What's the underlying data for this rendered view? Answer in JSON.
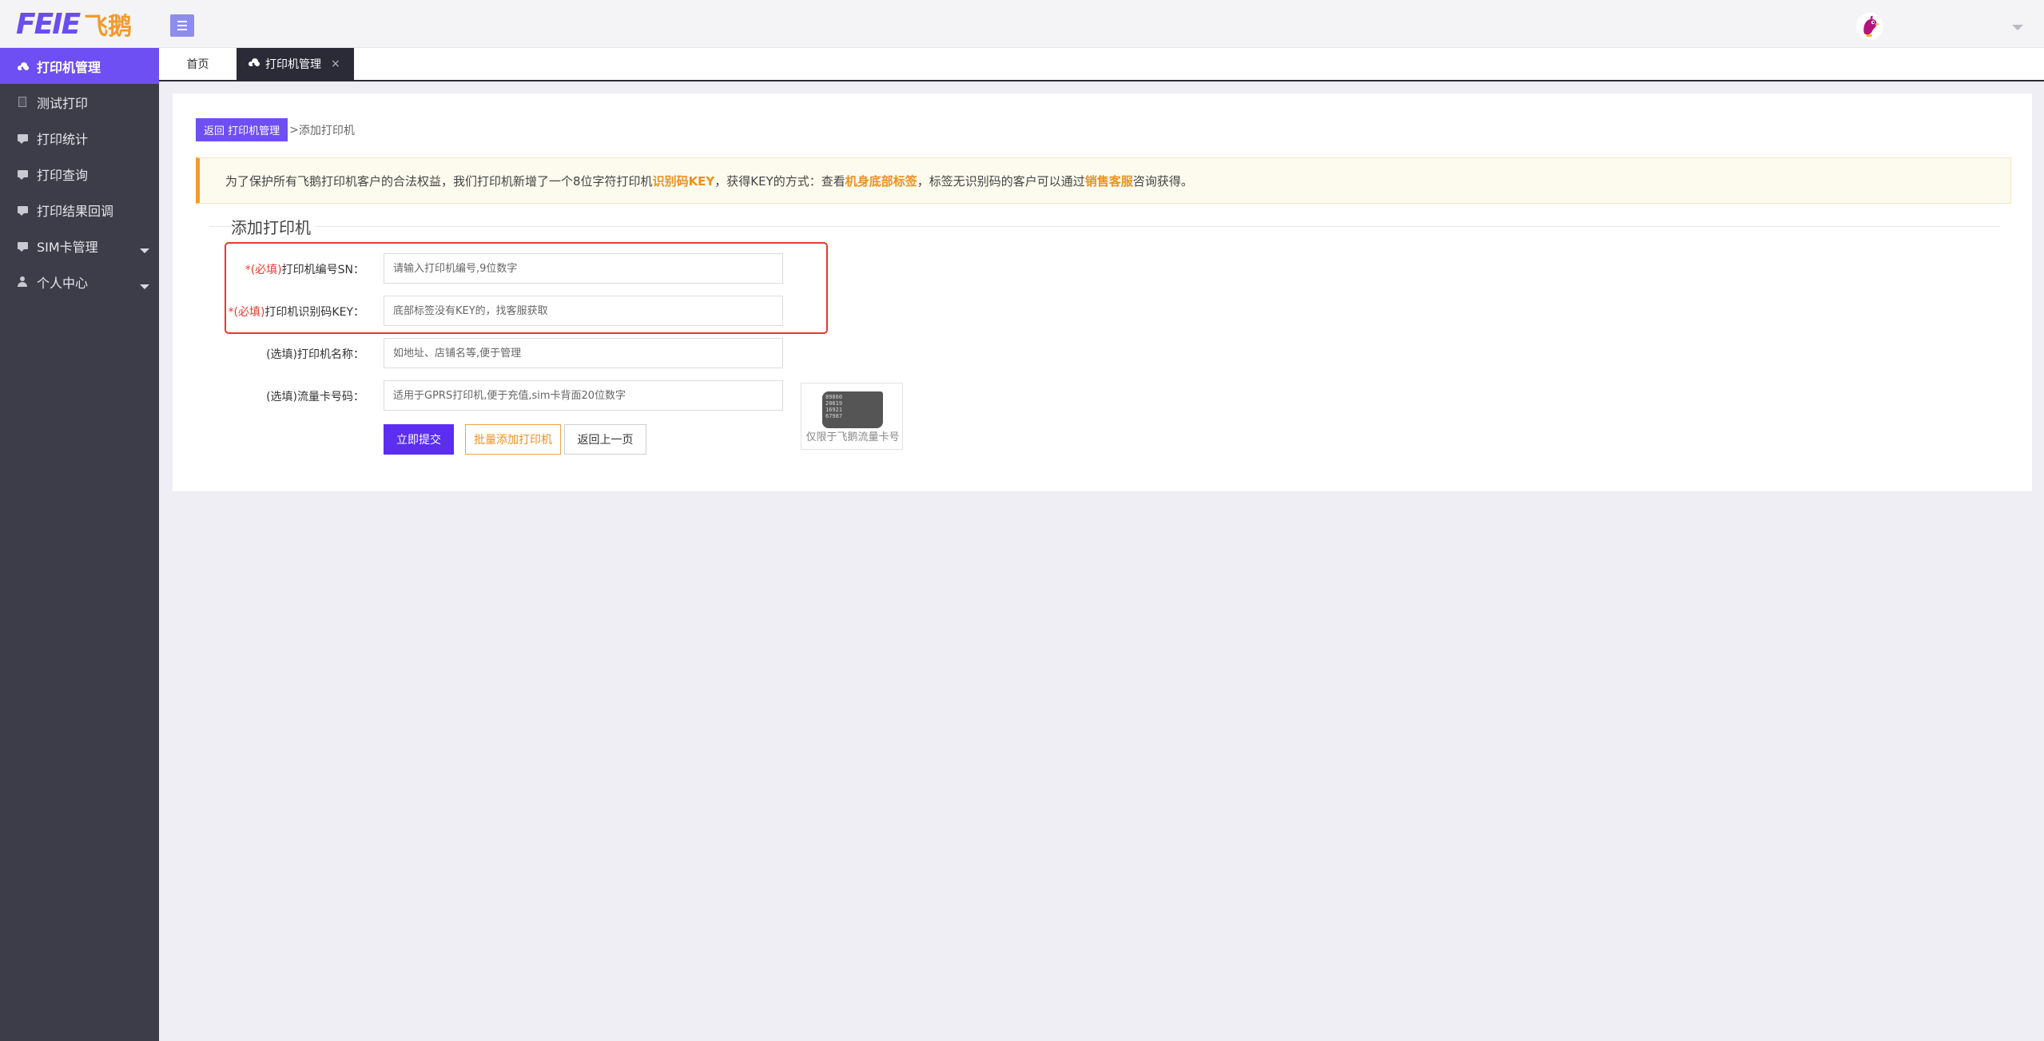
{
  "header": {
    "logo_latin": "FEIE",
    "logo_cjk": "飞鹅"
  },
  "sidebar": {
    "items": [
      {
        "label": "打印机管理",
        "icon": "cloud-icon",
        "active": true
      },
      {
        "label": "测试打印",
        "icon": "document-icon"
      },
      {
        "label": "打印统计",
        "icon": "comment-icon"
      },
      {
        "label": "打印查询",
        "icon": "comment-icon"
      },
      {
        "label": "打印结果回调",
        "icon": "comment-icon"
      },
      {
        "label": "SIM卡管理",
        "icon": "comment-icon",
        "expandable": true
      },
      {
        "label": "个人中心",
        "icon": "user-icon",
        "expandable": true
      }
    ]
  },
  "tabs": {
    "home": "首页",
    "current": "打印机管理",
    "close_glyph": "×"
  },
  "breadcrumb": {
    "back_button": "返回 打印机管理",
    "separator": ">",
    "current": "添加打印机"
  },
  "notice": {
    "part1": "为了保护所有飞鹅打印机客户的合法权益，我们打印机新增了一个8位字符打印机",
    "highlight1": "识别码KEY",
    "part2": "，获得KEY的方式：查看",
    "highlight2": "机身底部标签",
    "part3": "，标签无识别码的客户可以通过",
    "highlight3": "销售客服",
    "part4": "咨询获得。"
  },
  "form": {
    "legend": "添加打印机",
    "required_mark": "*(必填)",
    "sn": {
      "label": "打印机编号SN：",
      "placeholder": "请输入打印机编号,9位数字",
      "value": ""
    },
    "key": {
      "label": "打印机识别码KEY：",
      "placeholder": "底部标签没有KEY的，找客服获取",
      "value": ""
    },
    "name": {
      "label": "(选填)打印机名称：",
      "placeholder": "如地址、店铺名等,便于管理",
      "value": ""
    },
    "sim": {
      "label": "(选填)流量卡号码：",
      "placeholder": "适用于GPRS打印机,便于充值,sim卡背面20位数字",
      "value": ""
    },
    "buttons": {
      "submit": "立即提交",
      "batch": "批量添加打印机",
      "back": "返回上一页"
    },
    "sim_hint": {
      "card_lines": [
        "89860",
        "20619",
        "16921",
        "67987"
      ],
      "caption": "仅限于飞鹅流量卡号"
    }
  },
  "colors": {
    "accent": "#6e4ff3",
    "sidebar_bg": "#3d3d4a",
    "highlight": "#f0901c",
    "required_red": "#e53a2c"
  }
}
